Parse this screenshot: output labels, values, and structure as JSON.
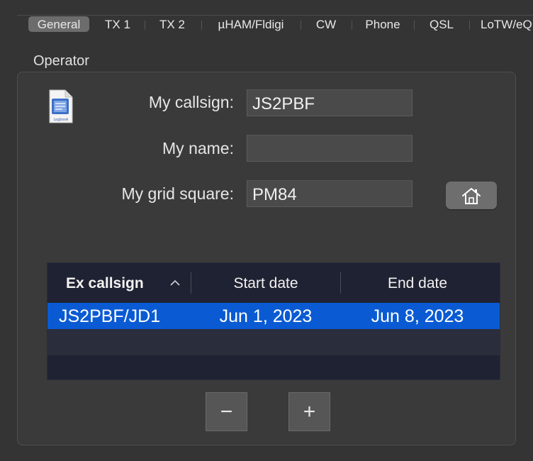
{
  "tabs": [
    {
      "label": "General",
      "selected": true
    },
    {
      "label": "TX 1"
    },
    {
      "label": "TX 2"
    },
    {
      "label": "µHAM/Fldigi"
    },
    {
      "label": "CW"
    },
    {
      "label": "Phone"
    },
    {
      "label": "QSL"
    },
    {
      "label": "LoTW/eQ"
    }
  ],
  "operator": {
    "title": "Operator",
    "icon": "logbook-document-icon",
    "icon_caption": "Logbook",
    "fields": {
      "callsign": {
        "label": "My callsign:",
        "value": "JS2PBF"
      },
      "name": {
        "label": "My name:",
        "value": ""
      },
      "grid": {
        "label": "My grid square:",
        "value": "PM84"
      }
    },
    "home_button_icon": "home-icon"
  },
  "ex_callsigns": {
    "columns": {
      "callsign": "Ex callsign",
      "start": "Start date",
      "end": "End date"
    },
    "sort_icon": "chevron-up-icon",
    "rows": [
      {
        "callsign": "JS2PBF/JD1",
        "start": "Jun 1, 2023",
        "end": "Jun 8, 2023",
        "selected": true
      }
    ],
    "remove_label": "−",
    "add_label": "+"
  },
  "colors": {
    "selection": "#0a5bd3",
    "background": "#343434",
    "tab_selected": "#6c6c6c"
  }
}
